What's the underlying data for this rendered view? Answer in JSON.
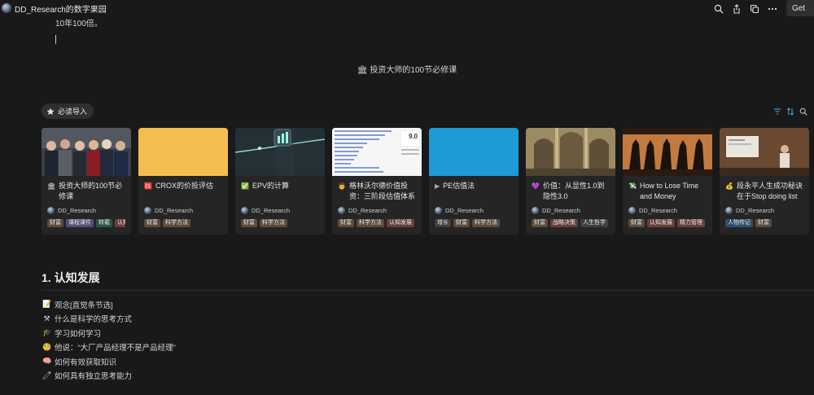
{
  "header": {
    "site_title": "DD_Research的数字果园",
    "get_label": "Get"
  },
  "intro": {
    "text": "10年100倍。"
  },
  "section": {
    "icon": "building-icon",
    "emoji": "🏛",
    "title": "投资大师的100节必修课"
  },
  "tab": {
    "label": "必读导入",
    "icon": "star-icon"
  },
  "cards": [
    {
      "emoji": "🏛",
      "title": "投资大师的100节必修课",
      "author": "DD_Research",
      "tags": [
        "财富",
        "课程课件",
        "转载",
        "认知发展"
      ]
    },
    {
      "emoji": "🆑",
      "title": "CROX的价投评估",
      "author": "DD_Research",
      "tags": [
        "财富",
        "科学方法"
      ]
    },
    {
      "emoji": "✅",
      "title": "EPV的计算",
      "author": "DD_Research",
      "tags": [
        "财富",
        "科学方法"
      ]
    },
    {
      "emoji": "👨",
      "title": "格林沃尔德价值投资：三阶段估值体系",
      "author": "DD_Research",
      "tags": [
        "财富",
        "科学方法",
        "认知发展"
      ]
    },
    {
      "emoji": "▶",
      "title": "PE估值法",
      "author": "DD_Research",
      "tags": [
        "增长",
        "财富",
        "科学方法"
      ]
    },
    {
      "emoji": "💜",
      "title": "价值：从显性1.0到隐性3.0",
      "author": "DD_Research",
      "tags": [
        "财富",
        "战略决策",
        "人生哲学"
      ]
    },
    {
      "emoji": "💸",
      "title": "How to Lose Time and Money",
      "author": "DD_Research",
      "tags": [
        "财富",
        "认知发展",
        "精力管理"
      ]
    },
    {
      "emoji": "💰",
      "title": "段永平人生成功秘诀在于Stop doing list",
      "author": "DD_Research",
      "tags": [
        "人物传记",
        "财富"
      ]
    }
  ],
  "cover_texts": {
    "score": "9.0"
  },
  "heading": {
    "title": "1. 认知发展"
  },
  "links": [
    {
      "emoji": "📝",
      "label": "观念[直觉条节选]"
    },
    {
      "emoji": "⚒",
      "label": "什么是科学的思考方式"
    },
    {
      "emoji": "🎓",
      "label": "学习如何学习"
    },
    {
      "emoji": "🧐",
      "label": "他说：“大厂产品经理不是产品经理”"
    },
    {
      "emoji": "🧠",
      "label": "如何有效获取知识"
    },
    {
      "emoji": "🧷",
      "label": "如何具有独立思考能力"
    }
  ],
  "colors": {
    "background": "#191919",
    "tag_brown": "#5c4b3b",
    "tag_purple": "#5a4a78",
    "tag_green": "#2f5443",
    "tag_red": "#6a3d3d",
    "tag_gray": "#3f3f3f",
    "tag_blue": "#2f4e6e",
    "accent_blue": "#4aa3df"
  }
}
